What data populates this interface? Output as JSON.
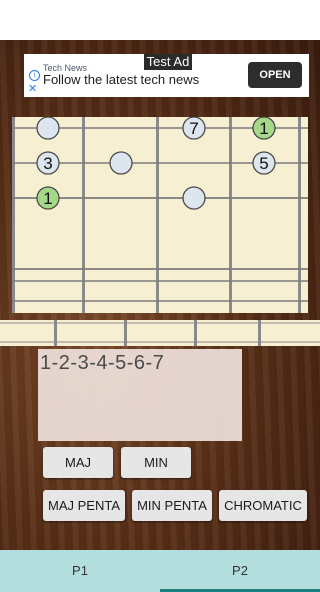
{
  "ad": {
    "tag": "Test Ad",
    "source": "Tech News",
    "title": "Follow the latest tech news",
    "button": "OPEN",
    "info_icon": "i",
    "close_icon": "✕"
  },
  "fretboard": {
    "notes": [
      {
        "label": "",
        "string": 1,
        "fret": 1
      },
      {
        "label": "7",
        "string": 1,
        "fret": 3
      },
      {
        "label": "1",
        "string": 1,
        "fret": 4,
        "root": true
      },
      {
        "label": "3",
        "string": 2,
        "fret": 1
      },
      {
        "label": "",
        "string": 2,
        "fret": 2
      },
      {
        "label": "5",
        "string": 2,
        "fret": 4
      },
      {
        "label": "1",
        "string": 3,
        "fret": 1,
        "root": true
      },
      {
        "label": "",
        "string": 3,
        "fret": 3
      }
    ],
    "note_color": "#dde6ee",
    "root_color": "#a6d88a"
  },
  "display": {
    "text": "1-2-3-4-5-6-7"
  },
  "buttons": {
    "maj": "MAJ",
    "min": "MIN",
    "maj_penta": "MAJ PENTA",
    "min_penta": "MIN PENTA",
    "chromatic": "CHROMATIC"
  },
  "nav": {
    "tabs": [
      "P1",
      "P2"
    ],
    "selected": "P2",
    "accent": "#1b7e7e"
  }
}
